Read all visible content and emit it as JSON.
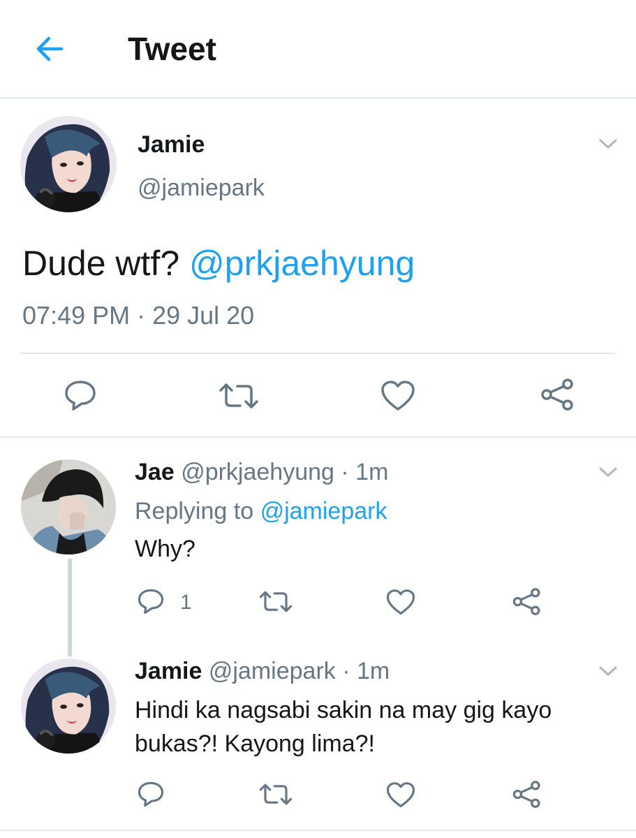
{
  "header": {
    "title": "Tweet",
    "back_icon": "arrow-left-icon",
    "accent_color": "#1da1f2"
  },
  "main_tweet": {
    "name": "Jamie",
    "handle": "@jamiepark",
    "text": "Dude wtf?",
    "mention": "@prkjaehyung",
    "timestamp": "07:49 PM · 29 Jul 20",
    "actions": [
      "reply-icon",
      "retweet-icon",
      "like-icon",
      "share-icon"
    ]
  },
  "replies": [
    {
      "name": "Jae",
      "handle": "@prkjaehyung",
      "time": "· 1m",
      "replying_prefix": "Replying to",
      "replying_to": "@jamiepark",
      "lines": [
        "Why?"
      ],
      "reply_count": "1"
    },
    {
      "name": "Jamie",
      "handle": "@jamiepark",
      "time": "· 1m",
      "lines": [
        "Hindi ka nagsabi sakin na may gig kayo",
        "bukas?! Kayong lima?!"
      ],
      "reply_count": ""
    }
  ],
  "colors": {
    "text": "#14171a",
    "secondary": "#657786",
    "link": "#1da1f2",
    "border": "#e1e8ed"
  }
}
